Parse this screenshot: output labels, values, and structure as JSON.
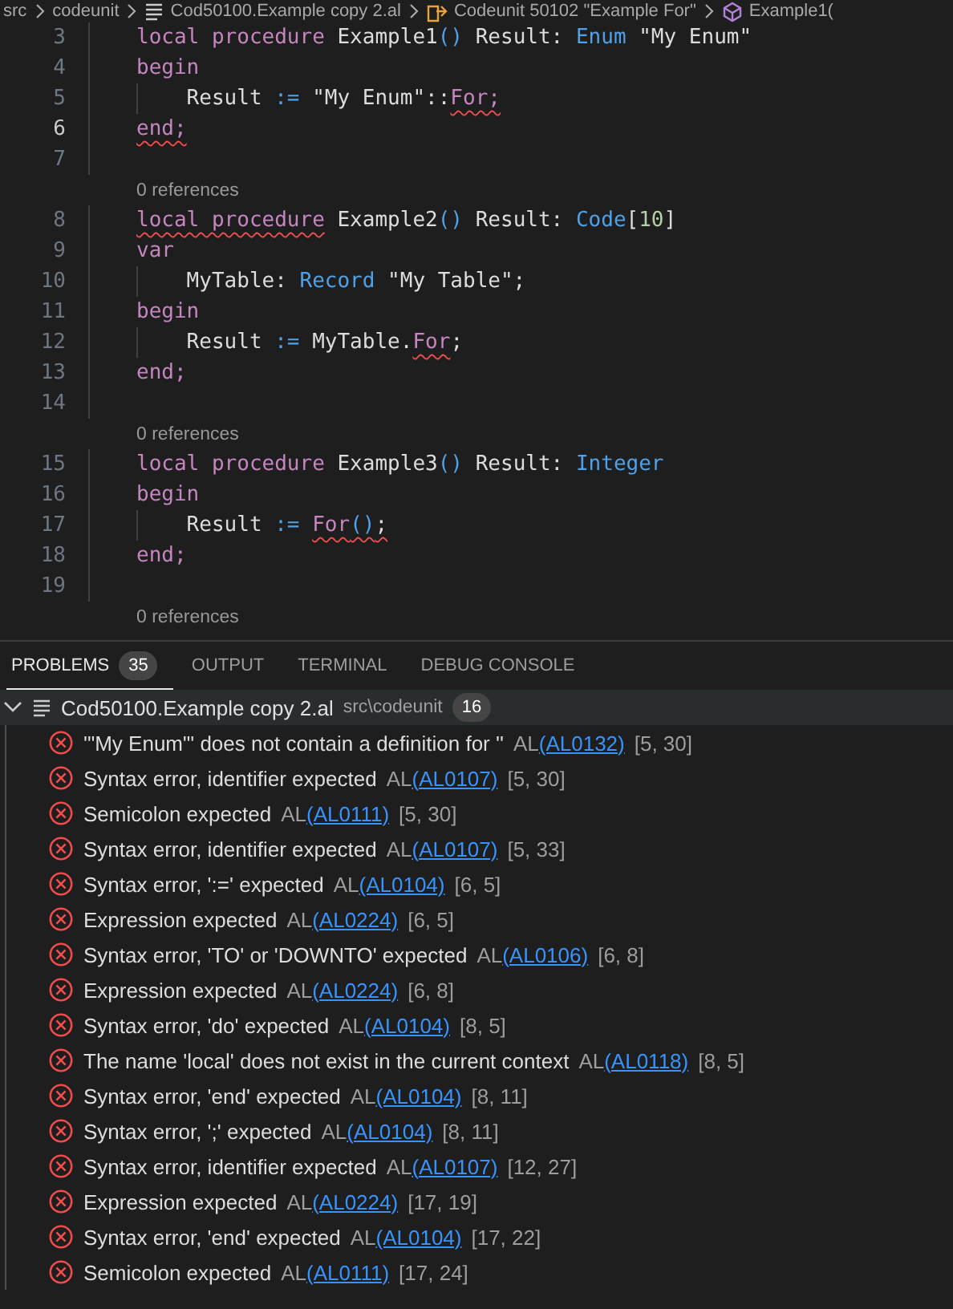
{
  "breadcrumb": [
    {
      "text": "src",
      "kind": "folder"
    },
    {
      "text": "codeunit",
      "kind": "folder"
    },
    {
      "text": "Cod50100.Example copy 2.al",
      "kind": "file"
    },
    {
      "text": "Codeunit 50102 \"Example For\"",
      "kind": "codeunit"
    },
    {
      "text": "Example1(",
      "kind": "method"
    }
  ],
  "editor": {
    "rows": [
      {
        "kind": "line",
        "number": "3",
        "current": false,
        "tokens": [
          {
            "t": "local procedure",
            "kind": "keyword"
          },
          {
            "t": " Example1",
            "kind": "plain"
          },
          {
            "t": "()",
            "kind": "type"
          },
          {
            "t": " Result: ",
            "kind": "plain"
          },
          {
            "t": "Enum",
            "kind": "type"
          },
          {
            "t": " \"My Enum\"",
            "kind": "plain"
          }
        ]
      },
      {
        "kind": "line",
        "number": "4",
        "current": false,
        "tokens": [
          {
            "t": "begin",
            "kind": "keyword"
          }
        ]
      },
      {
        "kind": "line",
        "number": "5",
        "current": false,
        "inner_guide": true,
        "tokens": [
          {
            "t": "    Result ",
            "kind": "plain"
          },
          {
            "t": ":=",
            "kind": "type"
          },
          {
            "t": " \"My Enum\"::",
            "kind": "plain"
          },
          {
            "t": "For;",
            "kind": "keyword",
            "squiggle": true
          }
        ]
      },
      {
        "kind": "line",
        "number": "6",
        "current": true,
        "tokens": [
          {
            "t": "end;",
            "kind": "keyword",
            "squiggle": true
          }
        ]
      },
      {
        "kind": "line",
        "number": "7",
        "current": false
      },
      {
        "kind": "lens",
        "text": "0 references"
      },
      {
        "kind": "line",
        "number": "8",
        "current": false,
        "tokens": [
          {
            "t": "local procedure",
            "kind": "keyword",
            "squiggle": true
          },
          {
            "t": " Example2",
            "kind": "plain"
          },
          {
            "t": "()",
            "kind": "type"
          },
          {
            "t": " Result: ",
            "kind": "plain"
          },
          {
            "t": "Code",
            "kind": "type"
          },
          {
            "t": "[",
            "kind": "plain"
          },
          {
            "t": "10",
            "kind": "number"
          },
          {
            "t": "]",
            "kind": "plain"
          }
        ]
      },
      {
        "kind": "line",
        "number": "9",
        "current": false,
        "tokens": [
          {
            "t": "var",
            "kind": "keyword"
          }
        ]
      },
      {
        "kind": "line",
        "number": "10",
        "current": false,
        "inner_guide": true,
        "tokens": [
          {
            "t": "    MyTable: ",
            "kind": "plain"
          },
          {
            "t": "Record",
            "kind": "type"
          },
          {
            "t": " \"My Table\";",
            "kind": "plain"
          }
        ]
      },
      {
        "kind": "line",
        "number": "11",
        "current": false,
        "tokens": [
          {
            "t": "begin",
            "kind": "keyword"
          }
        ]
      },
      {
        "kind": "line",
        "number": "12",
        "current": false,
        "inner_guide": true,
        "tokens": [
          {
            "t": "    Result ",
            "kind": "plain"
          },
          {
            "t": ":=",
            "kind": "type"
          },
          {
            "t": " MyTable.",
            "kind": "plain"
          },
          {
            "t": "For",
            "kind": "keyword",
            "squiggle": true
          },
          {
            "t": ";",
            "kind": "plain"
          }
        ]
      },
      {
        "kind": "line",
        "number": "13",
        "current": false,
        "tokens": [
          {
            "t": "end;",
            "kind": "keyword"
          }
        ]
      },
      {
        "kind": "line",
        "number": "14",
        "current": false
      },
      {
        "kind": "lens",
        "text": "0 references"
      },
      {
        "kind": "line",
        "number": "15",
        "current": false,
        "tokens": [
          {
            "t": "local procedure",
            "kind": "keyword"
          },
          {
            "t": " Example3",
            "kind": "plain"
          },
          {
            "t": "()",
            "kind": "type"
          },
          {
            "t": " Result: ",
            "kind": "plain"
          },
          {
            "t": "Integer",
            "kind": "type"
          }
        ]
      },
      {
        "kind": "line",
        "number": "16",
        "current": false,
        "tokens": [
          {
            "t": "begin",
            "kind": "keyword"
          }
        ]
      },
      {
        "kind": "line",
        "number": "17",
        "current": false,
        "inner_guide": true,
        "tokens": [
          {
            "t": "    Result ",
            "kind": "plain"
          },
          {
            "t": ":= ",
            "kind": "type"
          },
          {
            "t": "For",
            "kind": "keyword",
            "squiggle": true
          },
          {
            "t": "()",
            "kind": "type",
            "squiggle": true
          },
          {
            "t": ";",
            "kind": "plain",
            "squiggle": true
          }
        ]
      },
      {
        "kind": "line",
        "number": "18",
        "current": false,
        "tokens": [
          {
            "t": "end;",
            "kind": "keyword"
          }
        ]
      },
      {
        "kind": "line",
        "number": "19",
        "current": false
      },
      {
        "kind": "lens",
        "text": "0 references"
      }
    ]
  },
  "panel": {
    "tabs": [
      {
        "label": "PROBLEMS",
        "badge": "35",
        "selected": true
      },
      {
        "label": "OUTPUT",
        "selected": false
      },
      {
        "label": "TERMINAL",
        "selected": false
      },
      {
        "label": "DEBUG CONSOLE",
        "selected": false
      }
    ],
    "file_group": {
      "expanded": true,
      "name": "Cod50100.Example copy 2.al",
      "path": "src\\codeunit",
      "count": "16",
      "problems": [
        {
          "message": "'\"My Enum\"' does not contain a definition for ''",
          "source": "AL",
          "code": "(AL0132)",
          "location": "[5, 30]"
        },
        {
          "message": "Syntax error, identifier expected",
          "source": "AL",
          "code": "(AL0107)",
          "location": "[5, 30]"
        },
        {
          "message": "Semicolon expected",
          "source": "AL",
          "code": "(AL0111)",
          "location": "[5, 30]"
        },
        {
          "message": "Syntax error, identifier expected",
          "source": "AL",
          "code": "(AL0107)",
          "location": "[5, 33]"
        },
        {
          "message": "Syntax error, ':=' expected",
          "source": "AL",
          "code": "(AL0104)",
          "location": "[6, 5]"
        },
        {
          "message": "Expression expected",
          "source": "AL",
          "code": "(AL0224)",
          "location": "[6, 5]"
        },
        {
          "message": "Syntax error, 'TO' or 'DOWNTO' expected",
          "source": "AL",
          "code": "(AL0106)",
          "location": "[6, 8]"
        },
        {
          "message": "Expression expected",
          "source": "AL",
          "code": "(AL0224)",
          "location": "[6, 8]"
        },
        {
          "message": "Syntax error, 'do' expected",
          "source": "AL",
          "code": "(AL0104)",
          "location": "[8, 5]"
        },
        {
          "message": "The name 'local' does not exist in the current context",
          "source": "AL",
          "code": "(AL0118)",
          "location": "[8, 5]"
        },
        {
          "message": "Syntax error, 'end' expected",
          "source": "AL",
          "code": "(AL0104)",
          "location": "[8, 11]"
        },
        {
          "message": "Syntax error, ';' expected",
          "source": "AL",
          "code": "(AL0104)",
          "location": "[8, 11]"
        },
        {
          "message": "Syntax error, identifier expected",
          "source": "AL",
          "code": "(AL0107)",
          "location": "[12, 27]"
        },
        {
          "message": "Expression expected",
          "source": "AL",
          "code": "(AL0224)",
          "location": "[17, 19]"
        },
        {
          "message": "Syntax error, 'end' expected",
          "source": "AL",
          "code": "(AL0104)",
          "location": "[17, 22]"
        },
        {
          "message": "Semicolon expected",
          "source": "AL",
          "code": "(AL0111)",
          "location": "[17, 24]"
        }
      ]
    }
  }
}
